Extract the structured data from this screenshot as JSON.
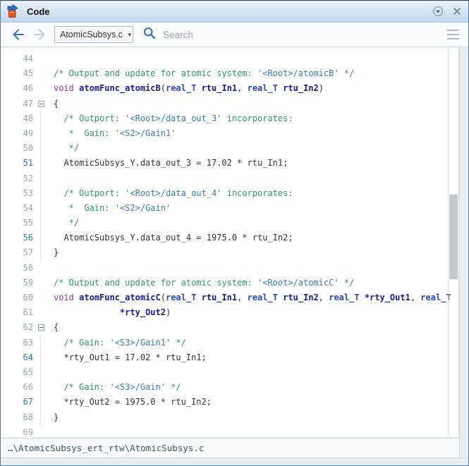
{
  "titlebar": {
    "title": "Code"
  },
  "toolbar": {
    "file_selector_value": "AtomicSubsys.c",
    "search_placeholder": "Search"
  },
  "colors": {
    "comment_green": "#2f9575",
    "link_blue": "#3a78be",
    "keyword_purple": "#9537a6",
    "identifier_navy": "#161d8e",
    "highlight_lineno_blue": "#2679cf",
    "titlebar_blue": "#c2d7ec",
    "app_icon_orange": "#e8581c",
    "app_icon_blue": "#2f71b8"
  },
  "code": {
    "first_line": 44,
    "last_line": 69,
    "lines": [
      {
        "n": 44,
        "tokens": []
      },
      {
        "n": 45,
        "tokens": [
          {
            "c": "c",
            "t": "/* Output and update for atomic system: "
          },
          {
            "c": "l",
            "t": "'<Root>/atomicB'"
          },
          {
            "c": "c",
            "t": " */"
          }
        ]
      },
      {
        "n": 46,
        "tokens": [
          {
            "c": "k",
            "t": "void"
          },
          {
            "c": "p",
            "t": " "
          },
          {
            "c": "i",
            "t": "atomFunc_atomicB"
          },
          {
            "c": "p",
            "t": "("
          },
          {
            "c": "t",
            "t": "real_T"
          },
          {
            "c": "p",
            "t": " "
          },
          {
            "c": "i",
            "t": "rtu_In1"
          },
          {
            "c": "p",
            "t": ", "
          },
          {
            "c": "t",
            "t": "real_T"
          },
          {
            "c": "p",
            "t": " "
          },
          {
            "c": "i",
            "t": "rtu_In2"
          },
          {
            "c": "p",
            "t": ")"
          }
        ]
      },
      {
        "n": 47,
        "fold": true,
        "tokens": [
          {
            "c": "p",
            "t": "{"
          }
        ]
      },
      {
        "n": 48,
        "g": true,
        "tokens": [
          {
            "c": "c",
            "t": "  /* Outport: "
          },
          {
            "c": "l",
            "t": "'<Root>/data_out_3'"
          },
          {
            "c": "c",
            "t": " incorporates:"
          }
        ]
      },
      {
        "n": 49,
        "g": true,
        "tokens": [
          {
            "c": "c",
            "t": "   *  Gain: "
          },
          {
            "c": "l",
            "t": "'<S2>/Gain1'"
          }
        ]
      },
      {
        "n": 50,
        "g": true,
        "tokens": [
          {
            "c": "c",
            "t": "   */"
          }
        ]
      },
      {
        "n": 51,
        "g": true,
        "hl": true,
        "tokens": [
          {
            "c": "p",
            "t": "  AtomicSubsys_Y.data_out_3 = 17.02 * rtu_In1;"
          }
        ]
      },
      {
        "n": 52,
        "g": true,
        "tokens": []
      },
      {
        "n": 53,
        "g": true,
        "tokens": [
          {
            "c": "c",
            "t": "  /* Outport: "
          },
          {
            "c": "l",
            "t": "'<Root>/data_out_4'"
          },
          {
            "c": "c",
            "t": " incorporates:"
          }
        ]
      },
      {
        "n": 54,
        "g": true,
        "tokens": [
          {
            "c": "c",
            "t": "   *  Gain: "
          },
          {
            "c": "l",
            "t": "'<S2>/Gain'"
          }
        ]
      },
      {
        "n": 55,
        "g": true,
        "tokens": [
          {
            "c": "c",
            "t": "   */"
          }
        ]
      },
      {
        "n": 56,
        "g": true,
        "hl": true,
        "tokens": [
          {
            "c": "p",
            "t": "  AtomicSubsys_Y.data_out_4 = 1975.0 * rtu_In2;"
          }
        ]
      },
      {
        "n": 57,
        "g": true,
        "tokens": [
          {
            "c": "p",
            "t": "}"
          }
        ]
      },
      {
        "n": 58,
        "tokens": []
      },
      {
        "n": 59,
        "tokens": [
          {
            "c": "c",
            "t": "/* Output and update for atomic system: "
          },
          {
            "c": "l",
            "t": "'<Root>/atomicC'"
          },
          {
            "c": "c",
            "t": " */"
          }
        ]
      },
      {
        "n": 60,
        "tokens": [
          {
            "c": "k",
            "t": "void"
          },
          {
            "c": "p",
            "t": " "
          },
          {
            "c": "i",
            "t": "atomFunc_atomicC"
          },
          {
            "c": "p",
            "t": "("
          },
          {
            "c": "t",
            "t": "real_T"
          },
          {
            "c": "p",
            "t": " "
          },
          {
            "c": "i",
            "t": "rtu_In1"
          },
          {
            "c": "p",
            "t": ", "
          },
          {
            "c": "t",
            "t": "real_T"
          },
          {
            "c": "p",
            "t": " "
          },
          {
            "c": "i",
            "t": "rtu_In2"
          },
          {
            "c": "p",
            "t": ", "
          },
          {
            "c": "t",
            "t": "real_T"
          },
          {
            "c": "p",
            "t": " "
          },
          {
            "c": "i",
            "t": "*rty_Out1"
          },
          {
            "c": "p",
            "t": ", "
          },
          {
            "c": "t",
            "t": "real_T"
          }
        ]
      },
      {
        "n": 61,
        "tokens": [
          {
            "c": "p",
            "t": "             "
          },
          {
            "c": "i",
            "t": "*rty_Out2"
          },
          {
            "c": "p",
            "t": ")"
          }
        ]
      },
      {
        "n": 62,
        "fold": true,
        "tokens": [
          {
            "c": "p",
            "t": "{"
          }
        ]
      },
      {
        "n": 63,
        "g": true,
        "tokens": [
          {
            "c": "c",
            "t": "  /* Gain: "
          },
          {
            "c": "l",
            "t": "'<S3>/Gain1'"
          },
          {
            "c": "c",
            "t": " */"
          }
        ]
      },
      {
        "n": 64,
        "g": true,
        "hl": true,
        "tokens": [
          {
            "c": "p",
            "t": "  *rty_Out1 = 17.02 * rtu_In1;"
          }
        ]
      },
      {
        "n": 65,
        "g": true,
        "tokens": []
      },
      {
        "n": 66,
        "g": true,
        "tokens": [
          {
            "c": "c",
            "t": "  /* Gain: "
          },
          {
            "c": "l",
            "t": "'<S3>/Gain'"
          },
          {
            "c": "c",
            "t": " */"
          }
        ]
      },
      {
        "n": 67,
        "g": true,
        "hl": true,
        "tokens": [
          {
            "c": "p",
            "t": "  *rty_Out2 = 1975.0 * rtu_In2;"
          }
        ]
      },
      {
        "n": 68,
        "g": true,
        "tokens": [
          {
            "c": "p",
            "t": "}"
          }
        ]
      },
      {
        "n": 69,
        "tokens": []
      }
    ]
  },
  "statusbar": {
    "path": "…\\AtomicSubsys_ert_rtw\\AtomicSubsys.c"
  }
}
